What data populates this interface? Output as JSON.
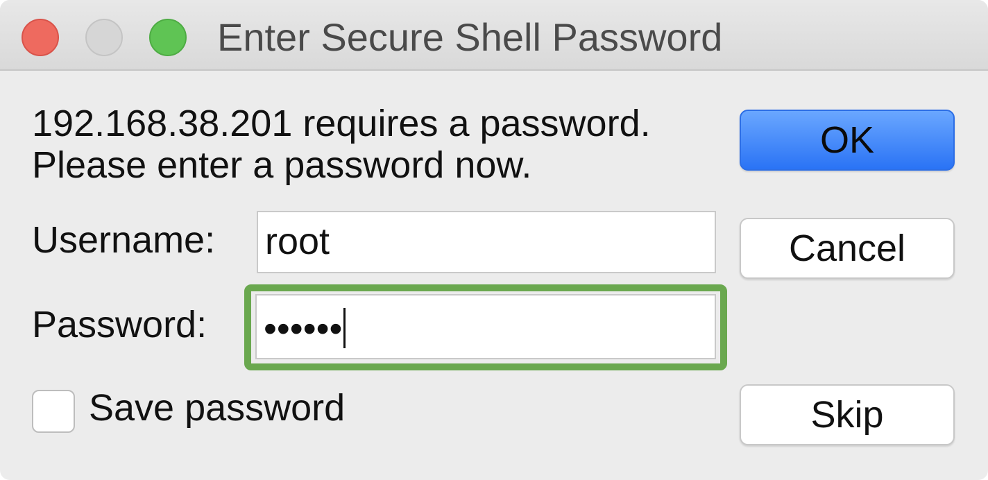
{
  "window": {
    "title": "Enter Secure Shell Password"
  },
  "message": {
    "line1": "192.168.38.201 requires a password.",
    "line2": "Please enter a password now."
  },
  "form": {
    "username_label": "Username:",
    "username_value": "root",
    "password_label": "Password:",
    "password_value_masked": "••••••",
    "save_password_label": "Save password",
    "save_password_checked": false
  },
  "buttons": {
    "ok": "OK",
    "cancel": "Cancel",
    "skip": "Skip"
  },
  "icons": {
    "close": "close-traffic-light",
    "minimize": "minimize-traffic-light",
    "zoom": "zoom-traffic-light"
  },
  "colors": {
    "ok_button": "#2a73f5",
    "focus_highlight": "#6aa84f"
  }
}
